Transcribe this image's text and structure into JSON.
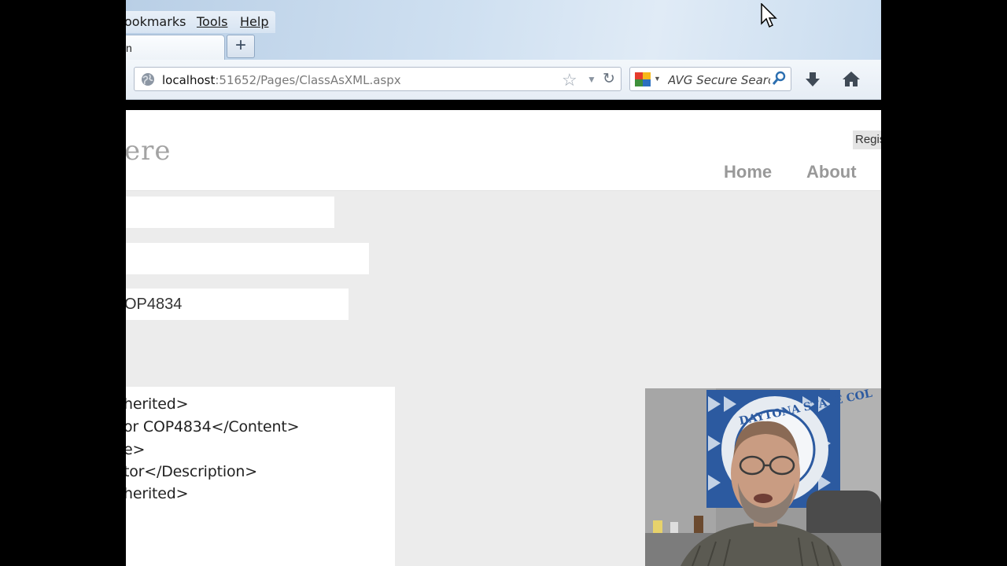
{
  "browser": {
    "menu": {
      "bookmarks_label": "ookmarks",
      "tools_label": "Tools",
      "help_label": "Help"
    },
    "tab": {
      "title": "n"
    },
    "newtab_label": "+",
    "url": {
      "host": "localhost",
      "rest": ":51652/Pages/ClassAsXML.aspx"
    },
    "search": {
      "placeholder": "AVG Secure Search"
    }
  },
  "site": {
    "title_fragment": "ere",
    "register_link": "Regis",
    "nav": {
      "home": "Home",
      "about": "About"
    }
  },
  "form": {
    "field1_value": "",
    "field2_value": "",
    "field3_value": "OP4834"
  },
  "xml_output": {
    "lines": [
      "herited>",
      "or COP4834</Content>",
      "e>",
      "tor</Description>",
      "herited>"
    ]
  },
  "webcam": {
    "seal_text": "DAYTONA STATE COL"
  },
  "colors": {
    "chrome_blue": "#cfe0f1",
    "nav_link": "#999999",
    "page_bg": "#ececec"
  }
}
